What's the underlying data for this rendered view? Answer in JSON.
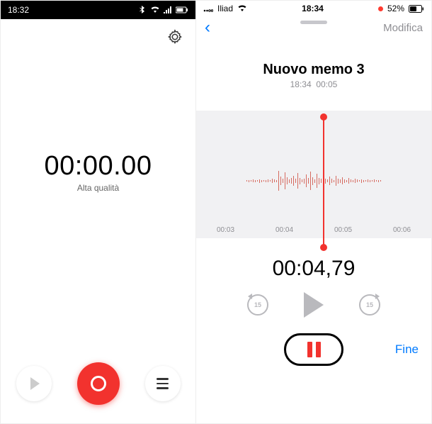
{
  "left": {
    "status_time": "18:32",
    "timer": "00:00.00",
    "subtitle": "Alta qualità"
  },
  "right": {
    "status_carrier": "Iliad",
    "status_time": "18:34",
    "status_battery": "52%",
    "nav_edit": "Modifica",
    "memo_title": "Nuovo memo 3",
    "memo_time": "18:34",
    "memo_duration": "00:05",
    "axis": [
      "00:03",
      "00:04",
      "00:05",
      "00:06"
    ],
    "timer": "00:04,79",
    "skip_seconds": "15",
    "done_label": "Fine"
  },
  "waveform_heights": [
    2,
    3,
    2,
    4,
    3,
    2,
    5,
    3,
    2,
    3,
    4,
    2,
    6,
    4,
    3,
    28,
    12,
    6,
    24,
    10,
    5,
    8,
    14,
    6,
    22,
    9,
    4,
    7,
    18,
    8,
    26,
    11,
    5,
    20,
    9,
    6,
    16,
    7,
    4,
    12,
    6,
    3,
    14,
    7,
    5,
    10,
    5,
    3,
    8,
    4,
    3,
    6,
    4,
    2,
    5,
    3,
    2,
    4,
    3,
    2,
    4,
    2,
    3,
    2
  ]
}
